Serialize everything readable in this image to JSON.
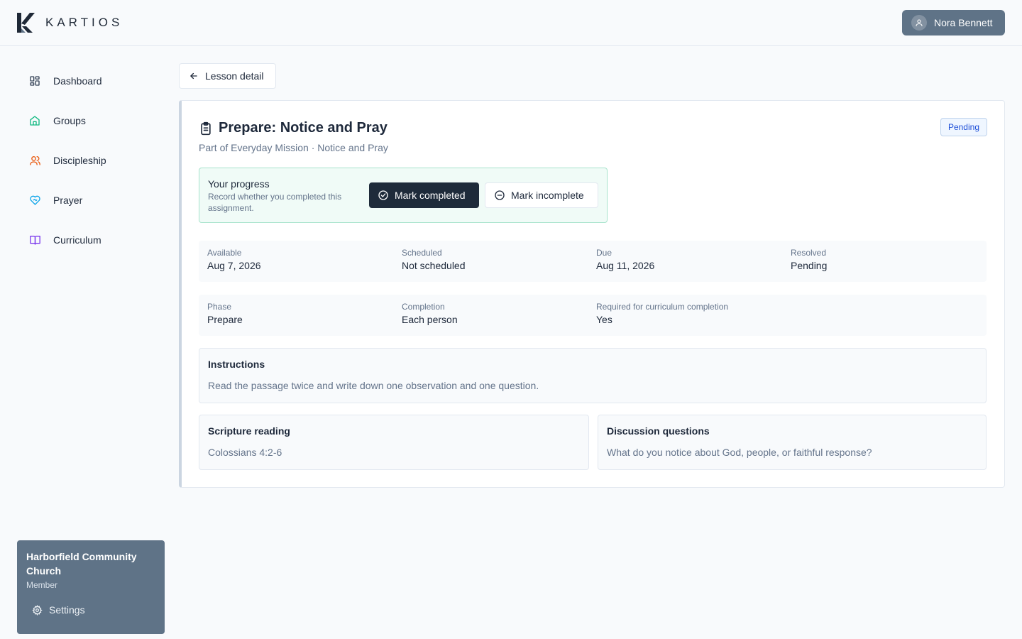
{
  "app": {
    "name": "KARTIOS"
  },
  "header": {
    "user_name": "Nora Bennett"
  },
  "sidebar": {
    "items": [
      {
        "label": "Dashboard",
        "icon": "dashboard-icon",
        "color": "#334155"
      },
      {
        "label": "Groups",
        "icon": "home-icon",
        "color": "#10b981"
      },
      {
        "label": "Discipleship",
        "icon": "users-icon",
        "color": "#ea580c"
      },
      {
        "label": "Prayer",
        "icon": "heart-handshake-icon",
        "color": "#0ea5e9"
      },
      {
        "label": "Curriculum",
        "icon": "book-open-icon",
        "color": "#7c3aed"
      }
    ],
    "org": {
      "name": "Harborfield Community Church",
      "role": "Member",
      "settings_label": "Settings"
    }
  },
  "back_button": {
    "label": "Lesson detail"
  },
  "assignment": {
    "title": "Prepare: Notice and Pray",
    "subtitle": "Part of Everyday Mission · Notice and Pray",
    "status_badge": "Pending",
    "progress": {
      "title": "Your progress",
      "description": "Record whether you completed this assignment.",
      "complete_label": "Mark completed",
      "incomplete_label": "Mark incomplete"
    },
    "meta_row1": [
      {
        "label": "Available",
        "value": "Aug 7, 2026"
      },
      {
        "label": "Scheduled",
        "value": "Not scheduled"
      },
      {
        "label": "Due",
        "value": "Aug 11, 2026"
      },
      {
        "label": "Resolved",
        "value": "Pending"
      }
    ],
    "meta_row2": [
      {
        "label": "Phase",
        "value": "Prepare"
      },
      {
        "label": "Completion",
        "value": "Each person"
      },
      {
        "label": "Required for curriculum completion",
        "value": "Yes"
      }
    ],
    "instructions": {
      "title": "Instructions",
      "body": "Read the passage twice and write down one observation and one question."
    },
    "scripture": {
      "title": "Scripture reading",
      "body": "Colossians 4:2-6"
    },
    "discussion": {
      "title": "Discussion questions",
      "body": "What do you notice about God, people, or faithful response?"
    }
  },
  "colors": {
    "accent_dark": "#1e2b3a",
    "slate": "#5f7387",
    "pending_badge": "#1d4ed8",
    "progress_border": "#a7e3cc"
  }
}
